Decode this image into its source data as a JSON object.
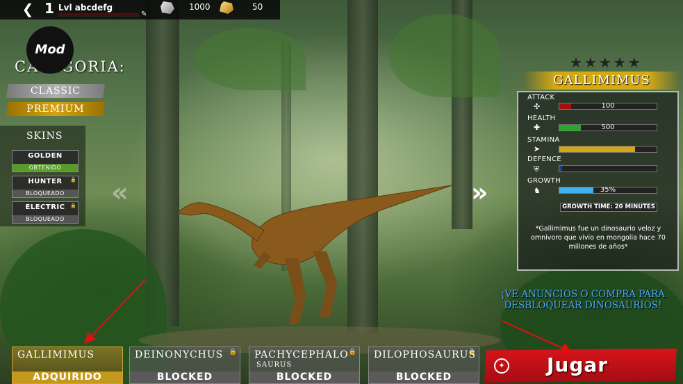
{
  "topbar": {
    "level": "1",
    "username": "Lvl abcdefg",
    "stone": "1000",
    "gold": "50",
    "xp_fraction": 0.0
  },
  "mod_badge": "Mod",
  "category": {
    "title": "CATEGORIA:",
    "classic": "CLASSIC",
    "premium": "PREMIUM"
  },
  "skins": {
    "title": "SKINS",
    "items": [
      {
        "name": "GOLDEN",
        "status": "OBTENIDO"
      },
      {
        "name": "HUNTER",
        "status": "BLOQUEADO"
      },
      {
        "name": "ELECTRIC",
        "status": "BLOQUEADO"
      }
    ]
  },
  "dino": {
    "name": "GALLIMIMUS",
    "stats": [
      {
        "label": "ATTACK",
        "value": "100",
        "fraction": 0.12,
        "color": "#a01212"
      },
      {
        "label": "HEALTH",
        "value": "500",
        "fraction": 0.22,
        "color": "#28a828"
      },
      {
        "label": "STAMINA",
        "value": "",
        "fraction": 0.78,
        "color": "#d4a514"
      },
      {
        "label": "DEFENCE",
        "value": "",
        "fraction": 0.03,
        "color": "#1a3fa0"
      },
      {
        "label": "GROWTH",
        "value": "35%",
        "fraction": 0.35,
        "color": "#3fb0f0"
      }
    ],
    "growth_time": "GROWTH TIME: 20 MINUTES",
    "description": "*Gallimimus fue un dinosaurio veloz y omnivoro que vivio en mongolia hace 70 millones de años*",
    "stars": "★★★★★"
  },
  "promo": "¡VE ANUNCIOS O COMPRA PARA DESBLOQUEAR DINOSAURIOS!",
  "cards": [
    {
      "name": "GALLIMIMUS",
      "name2": "",
      "status": "ADQUIRIDO"
    },
    {
      "name": "DEINONYCHUS",
      "name2": "",
      "status": "BLOCKED"
    },
    {
      "name": "PACHYCEPHALO",
      "name2": "SAURUS",
      "status": "BLOCKED"
    },
    {
      "name": "DILOPHOSAURUS",
      "name2": "",
      "status": "BLOCKED"
    }
  ],
  "play_label": "Jugar"
}
